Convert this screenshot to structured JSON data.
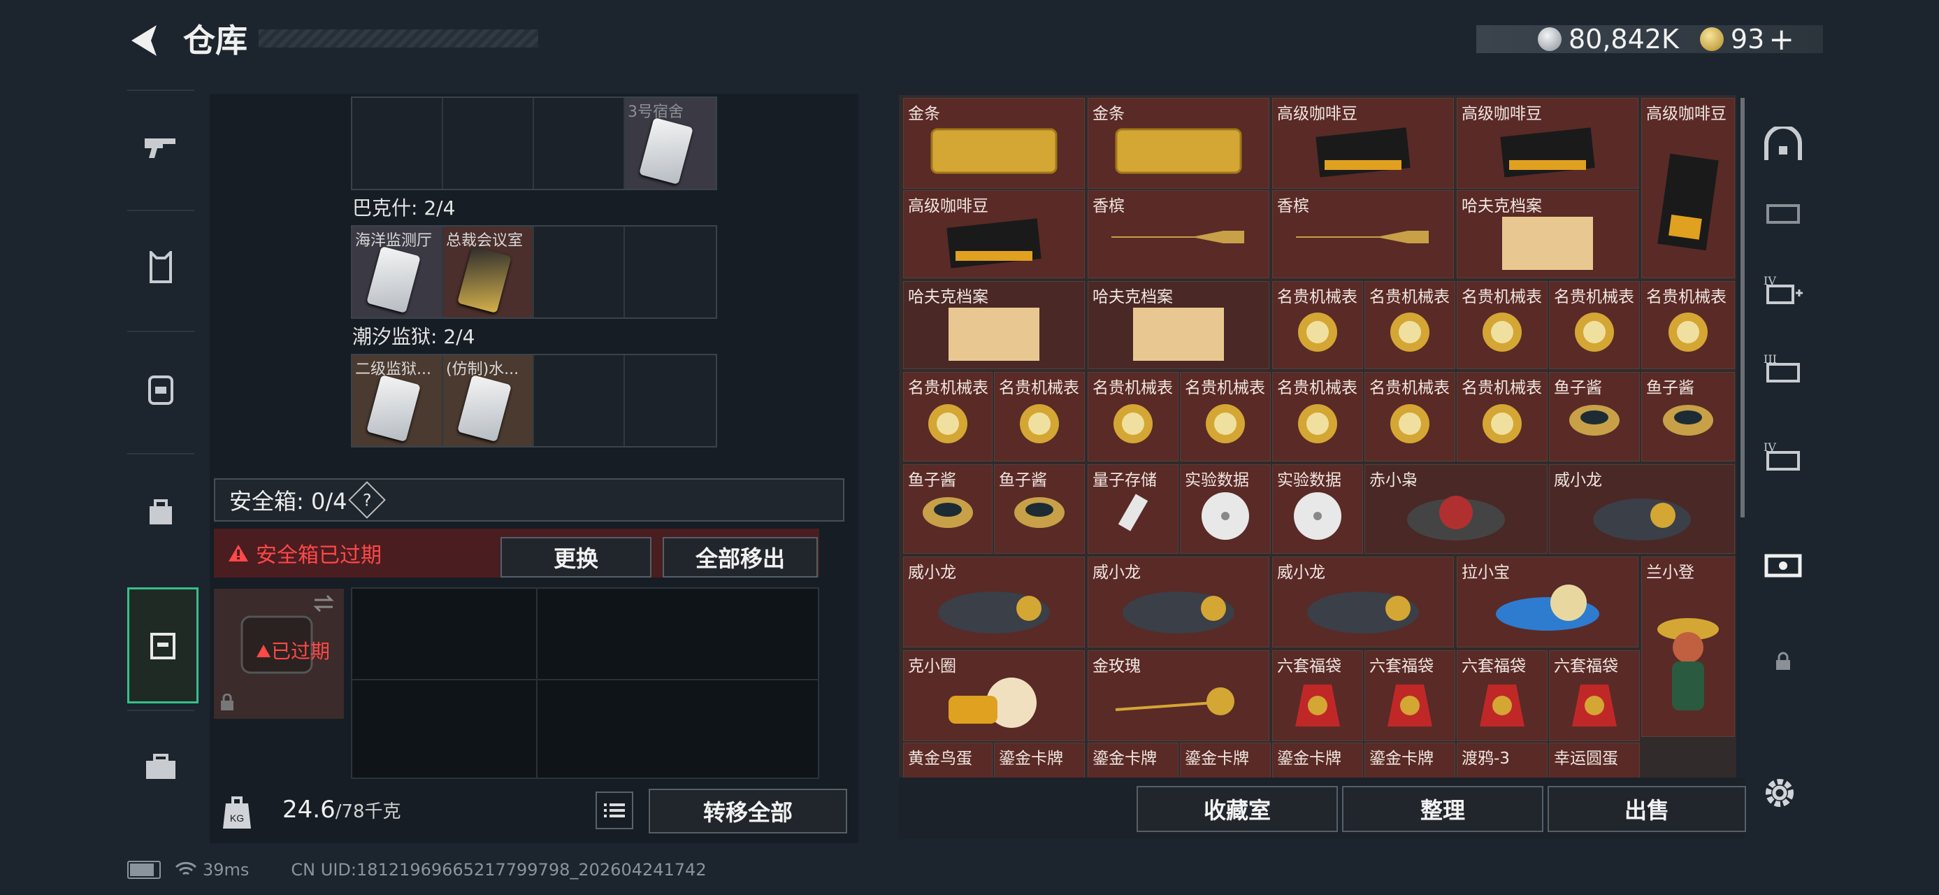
{
  "header": {
    "title": "仓库",
    "currency1": "80,842K",
    "currency2": "93",
    "plus": "+"
  },
  "rail": {
    "items": [
      "weapon-icon",
      "armor-vest-icon",
      "backpack-icon",
      "bag-icon",
      "safebox-icon",
      "briefcase-icon"
    ]
  },
  "left": {
    "top_row": {
      "slot4_label": "3号宿舍"
    },
    "groups": [
      {
        "label": "巴克什: 2/4",
        "slots": [
          "海洋监测厅",
          "总裁会议室"
        ]
      },
      {
        "label": "潮汐监狱: 2/4",
        "slots": [
          "二级监狱...",
          "(仿制)水..."
        ]
      }
    ],
    "safebox": {
      "label": "安全箱: 0/4",
      "help": "?",
      "expired_warning": "安全箱已过期",
      "expired_badge": "已过期",
      "replace": "更换",
      "move_all": "全部移出"
    },
    "weight": {
      "current": "24.6",
      "max": "/78千克",
      "kg_icon": "KG"
    },
    "transfer_all": "转移全部"
  },
  "stash": {
    "row1": [
      "金条",
      "金条",
      "高级咖啡豆",
      "高级咖啡豆",
      "高级咖啡豆"
    ],
    "row2": [
      "高级咖啡豆",
      "香槟",
      "香槟",
      "哈夫克档案"
    ],
    "row3": [
      "哈夫克档案",
      "哈夫克档案",
      "名贵机械表",
      "名贵机械表",
      "名贵机械表",
      "名贵机械表",
      "名贵机械表"
    ],
    "row4": [
      "名贵机械表",
      "名贵机械表",
      "名贵机械表",
      "名贵机械表",
      "名贵机械表",
      "名贵机械表",
      "名贵机械表",
      "鱼子酱",
      "鱼子酱"
    ],
    "row5": [
      "鱼子酱",
      "鱼子酱",
      "量子存储",
      "实验数据",
      "实验数据",
      "赤小枭",
      "威小龙"
    ],
    "row6": [
      "威小龙",
      "威小龙",
      "威小龙",
      "拉小宝",
      "兰小登"
    ],
    "row7": [
      "克小圈",
      "金玫瑰",
      "六套福袋",
      "六套福袋",
      "六套福袋",
      "六套福袋"
    ],
    "row8": [
      "黄金鸟蛋",
      "鎏金卡牌",
      "鎏金卡牌",
      "鎏金卡牌",
      "鎏金卡牌",
      "鎏金卡牌",
      "渡鸦-3",
      "幸运圆蛋"
    ]
  },
  "bottom": {
    "collection": "收藏室",
    "sort": "整理",
    "sell": "出售"
  },
  "status": {
    "ping": "39ms",
    "uid": "CN UID:181219696652177997​98_202604241742"
  }
}
